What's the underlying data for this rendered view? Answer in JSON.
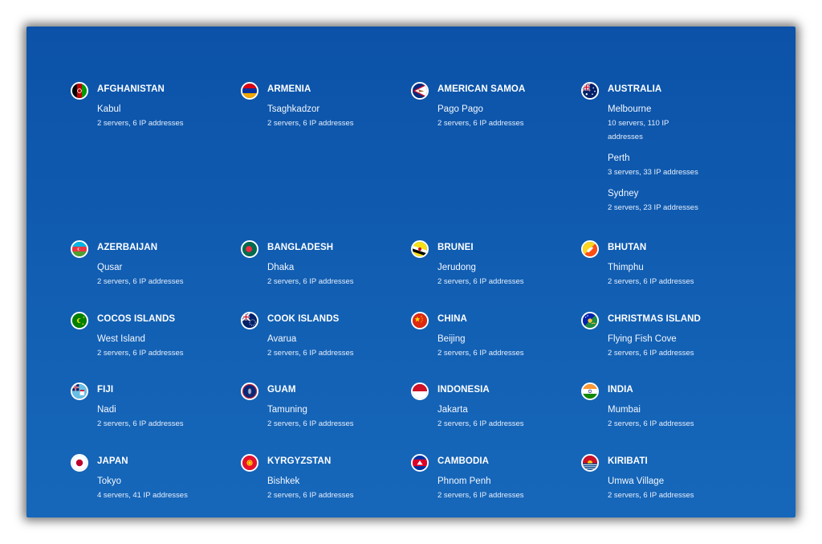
{
  "locations": [
    {
      "country": "AFGHANISTAN",
      "flag": "afghanistan-flag-icon",
      "cities": [
        {
          "name": "Kabul",
          "meta": "2 servers, 6 IP addresses"
        }
      ]
    },
    {
      "country": "ARMENIA",
      "flag": "armenia-flag-icon",
      "cities": [
        {
          "name": "Tsaghkadzor",
          "meta": "2 servers, 6 IP addresses"
        }
      ]
    },
    {
      "country": "AMERICAN SAMOA",
      "flag": "american-samoa-flag-icon",
      "cities": [
        {
          "name": "Pago Pago",
          "meta": "2 servers, 6 IP addresses"
        }
      ]
    },
    {
      "country": "AUSTRALIA",
      "flag": "australia-flag-icon",
      "cities": [
        {
          "name": "Melbourne",
          "meta": "10 servers, 110 IP addresses"
        },
        {
          "name": "Perth",
          "meta": "3 servers, 33 IP addresses"
        },
        {
          "name": "Sydney",
          "meta": "2 servers, 23 IP addresses"
        }
      ]
    },
    {
      "country": "AZERBAIJAN",
      "flag": "azerbaijan-flag-icon",
      "cities": [
        {
          "name": "Qusar",
          "meta": "2 servers, 6 IP addresses"
        }
      ]
    },
    {
      "country": "BANGLADESH",
      "flag": "bangladesh-flag-icon",
      "cities": [
        {
          "name": "Dhaka",
          "meta": "2 servers, 6 IP addresses"
        }
      ]
    },
    {
      "country": "BRUNEI",
      "flag": "brunei-flag-icon",
      "cities": [
        {
          "name": "Jerudong",
          "meta": "2 servers, 6 IP addresses"
        }
      ]
    },
    {
      "country": "BHUTAN",
      "flag": "bhutan-flag-icon",
      "cities": [
        {
          "name": "Thimphu",
          "meta": "2 servers, 6 IP addresses"
        }
      ]
    },
    {
      "country": "COCOS ISLANDS",
      "flag": "cocos-islands-flag-icon",
      "cities": [
        {
          "name": "West Island",
          "meta": "2 servers, 6 IP addresses"
        }
      ]
    },
    {
      "country": "COOK ISLANDS",
      "flag": "cook-islands-flag-icon",
      "cities": [
        {
          "name": "Avarua",
          "meta": "2 servers, 6 IP addresses"
        }
      ]
    },
    {
      "country": "CHINA",
      "flag": "china-flag-icon",
      "cities": [
        {
          "name": "Beijing",
          "meta": "2 servers, 6 IP addresses"
        }
      ]
    },
    {
      "country": "CHRISTMAS ISLAND",
      "flag": "christmas-island-flag-icon",
      "cities": [
        {
          "name": "Flying Fish Cove",
          "meta": "2 servers, 6 IP addresses"
        }
      ]
    },
    {
      "country": "FIJI",
      "flag": "fiji-flag-icon",
      "cities": [
        {
          "name": "Nadi",
          "meta": "2 servers, 6 IP addresses"
        }
      ]
    },
    {
      "country": "GUAM",
      "flag": "guam-flag-icon",
      "cities": [
        {
          "name": "Tamuning",
          "meta": "2 servers, 6 IP addresses"
        }
      ]
    },
    {
      "country": "INDONESIA",
      "flag": "indonesia-flag-icon",
      "cities": [
        {
          "name": "Jakarta",
          "meta": "2 servers, 6 IP addresses"
        }
      ]
    },
    {
      "country": "INDIA",
      "flag": "india-flag-icon",
      "cities": [
        {
          "name": "Mumbai",
          "meta": "2 servers, 6 IP addresses"
        }
      ]
    },
    {
      "country": "JAPAN",
      "flag": "japan-flag-icon",
      "cities": [
        {
          "name": "Tokyo",
          "meta": "4 servers, 41 IP addresses"
        }
      ]
    },
    {
      "country": "KYRGYZSTAN",
      "flag": "kyrgyzstan-flag-icon",
      "cities": [
        {
          "name": "Bishkek",
          "meta": "2 servers, 6 IP addresses"
        }
      ]
    },
    {
      "country": "CAMBODIA",
      "flag": "cambodia-flag-icon",
      "cities": [
        {
          "name": "Phnom Penh",
          "meta": "2 servers, 6 IP addresses"
        }
      ]
    },
    {
      "country": "KIRIBATI",
      "flag": "kiribati-flag-icon",
      "cities": [
        {
          "name": "Umwa Village",
          "meta": "2 servers, 6 IP addresses"
        }
      ]
    }
  ]
}
